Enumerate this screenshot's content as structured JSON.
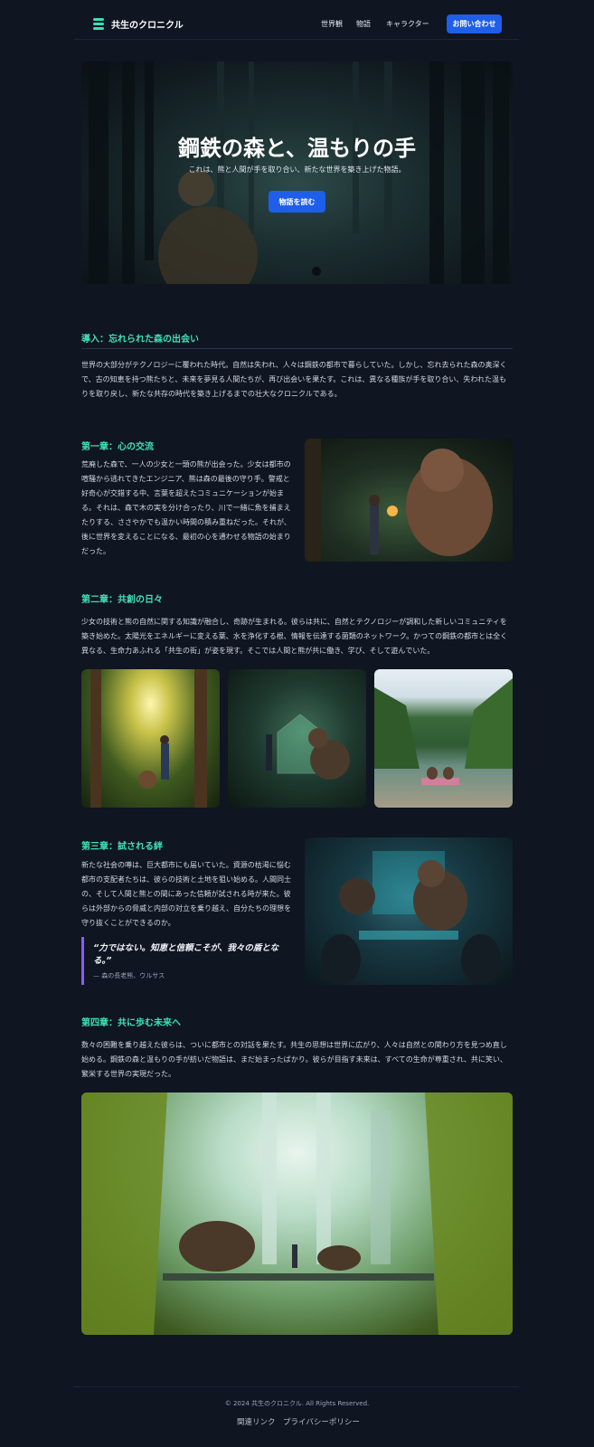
{
  "header": {
    "logo_text": "共生のクロニクル",
    "nav": [
      "世界観",
      "物語",
      "キャラクター"
    ],
    "contact_button": "お問い合わせ"
  },
  "hero": {
    "title": "鋼鉄の森と、温もりの手",
    "subtitle": "これは、熊と人間が手を取り合い、新たな世界を築き上げた物語。",
    "button": "物語を読む"
  },
  "intro": {
    "title": "導入：忘れられた森の出会い",
    "text": "世界の大部分がテクノロジーに覆われた時代。自然は失われ、人々は鋼鉄の都市で暮らしていた。しかし、忘れ去られた森の奥深くで、古の知恵を持つ熊たちと、未来を夢見る人間たちが、再び出会いを果たす。これは、異なる種族が手を取り合い、失われた温もりを取り戻し、新たな共存の時代を築き上げるまでの壮大なクロニクルである。"
  },
  "chapter1": {
    "title": "第一章：心の交流",
    "text": "荒廃した森で、一人の少女と一頭の熊が出会った。少女は都市の喧騒から逃れてきたエンジニア、熊は森の最後の守り手。警戒と好奇心が交錯する中、言葉を超えたコミュニケーションが始まる。それは、森で木の実を分け合ったり、川で一緒に魚を捕まえたりする、ささやかでも温かい時間の積み重ねだった。それが、後に世界を変えることになる、最初の心を通わせる物語の始まりだった。"
  },
  "chapter2": {
    "title": "第二章：共創の日々",
    "text": "少女の技術と熊の自然に関する知識が融合し、奇跡が生まれる。彼らは共に、自然とテクノロジーが調和した新しいコミュニティを築き始めた。太陽光をエネルギーに変える葉、水を浄化する根、情報を伝達する菌類のネットワーク。かつての鋼鉄の都市とは全く異なる、生命力あふれる「共生の街」が姿を現す。そこでは人間と熊が共に働き、学び、そして遊んでいた。"
  },
  "chapter3": {
    "title": "第三章：試される絆",
    "text": "新たな社会の噂は、巨大都市にも届いていた。資源の枯渇に悩む都市の支配者たちは、彼らの技術と土地を狙い始める。人間同士の、そして人間と熊との間にあった信頼が試される時が来た。彼らは外部からの脅威と内部の対立を乗り越え、自分たちの理想を守り抜くことができるのか。",
    "quote": "“力ではない。知恵と信頼こそが、我々の盾となる。”",
    "quote_author": "— 森の長老熊、ウルサス"
  },
  "chapter4": {
    "title": "第四章：共に歩む未来へ",
    "text": "数々の困難を乗り越えた彼らは、ついに都市との対話を果たす。共生の思想は世界に広がり、人々は自然との関わり方を見つめ直し始める。鋼鉄の森と温もりの手が紡いだ物語は、まだ始まったばかり。彼らが目指す未来は、すべての生命が尊重され、共に笑い、繁栄する世界の実現だった。"
  },
  "footer": {
    "copyright": "© 2024 共生のクロニクル. All Rights Reserved.",
    "links": [
      "関連リンク",
      "プライバシーポリシー"
    ]
  },
  "colors": {
    "background": "#0f1521",
    "accent": "#3ee0b4",
    "button": "#1e5ee8",
    "quote_border": "#8b5cf6"
  }
}
